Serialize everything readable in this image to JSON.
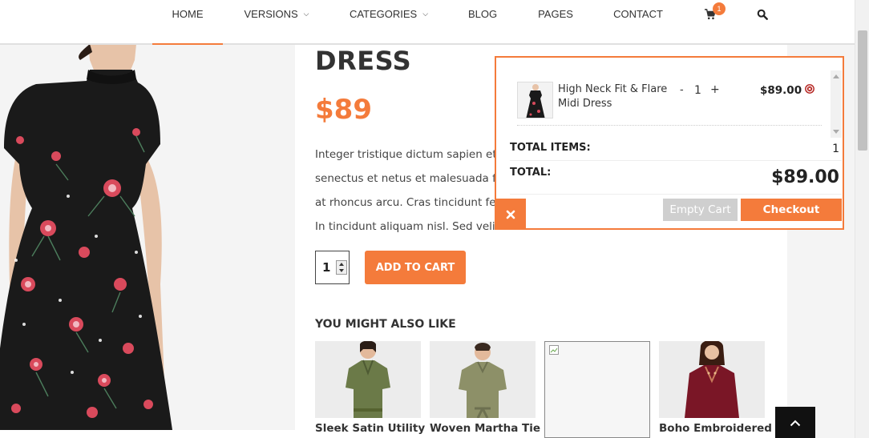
{
  "nav": {
    "items": [
      {
        "label": "HOME",
        "active": true
      },
      {
        "label": "VERSIONS",
        "has_caret": true
      },
      {
        "label": "CATEGORIES",
        "has_caret": true
      },
      {
        "label": "BLOG"
      },
      {
        "label": "PAGES"
      },
      {
        "label": "CONTACT"
      }
    ],
    "cart_count": "1",
    "icons": [
      "cart-icon",
      "search-icon"
    ]
  },
  "product": {
    "title": "DRESS",
    "price": "$89",
    "description_lines": [
      "Integer tristique dictum sapien et",
      "senectus et netus et malesuada fa",
      "at rhoncus arcu. Cras tincidunt feli",
      "In tincidunt aliquam nisl. Sed velit"
    ],
    "quantity": "1",
    "add_to_cart_label": "ADD TO CART"
  },
  "related": {
    "title": "YOU MIGHT ALSO LIKE",
    "items": [
      {
        "name": "Sleek Satin Utility"
      },
      {
        "name": "Woven Martha Tie"
      },
      {
        "name": ""
      },
      {
        "name": "Boho Embroidered"
      }
    ]
  },
  "cart_popup": {
    "item": {
      "name": "High Neck Fit & Flare Midi Dress",
      "minus": "-",
      "qty": "1",
      "plus": "+",
      "price": "$89.00"
    },
    "total_items_label": "TOTAL ITEMS:",
    "total_items_value": "1",
    "total_label": "TOTAL:",
    "total_value": "$89.00",
    "empty_label": "Empty Cart",
    "checkout_label": "Checkout"
  },
  "colors": {
    "accent": "#f47b3b",
    "text": "#333333",
    "dress": "#1a1a1a"
  }
}
